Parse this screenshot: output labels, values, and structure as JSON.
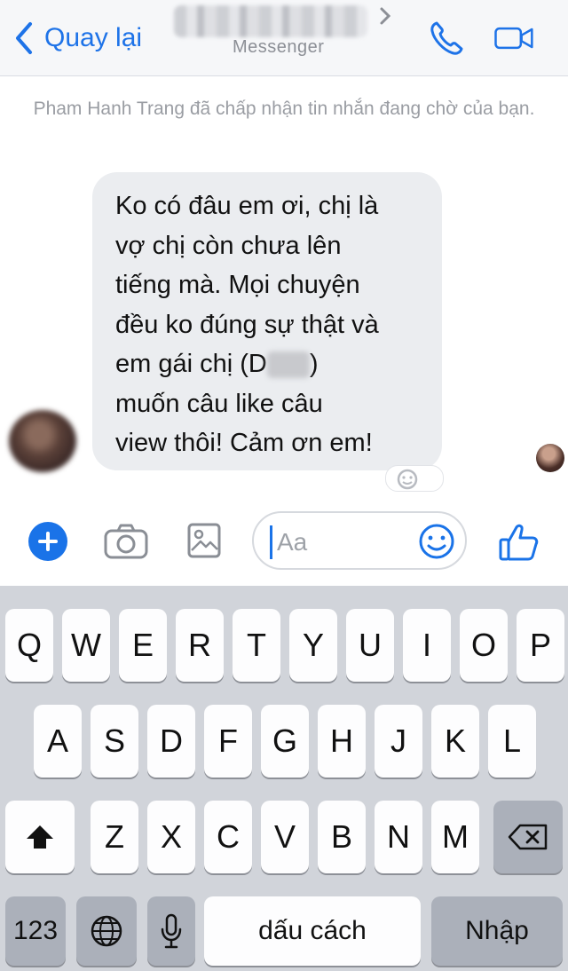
{
  "header": {
    "back_label": "Quay lại",
    "subtitle": "Messenger"
  },
  "notice": "Pham Hanh Trang đã chấp nhận tin nhắn đang chờ của bạn.",
  "message": {
    "lines": [
      "Ko có đâu em ơi, chị là",
      "vợ chị còn chưa lên",
      "tiếng mà. Mọi chuyện",
      "đều ko đúng sự thật và"
    ],
    "line5_prefix": "em gái chị (D",
    "line5_suffix": ")",
    "line6": "muốn câu like câu",
    "line7": "view thôi! Cảm ơn em!"
  },
  "composer": {
    "placeholder": "Aa"
  },
  "keyboard": {
    "row1": [
      "Q",
      "W",
      "E",
      "R",
      "T",
      "Y",
      "U",
      "I",
      "O",
      "P"
    ],
    "row2": [
      "A",
      "S",
      "D",
      "F",
      "G",
      "H",
      "J",
      "K",
      "L"
    ],
    "row3": [
      "Z",
      "X",
      "C",
      "V",
      "B",
      "N",
      "M"
    ],
    "numbers_label": "123",
    "space_label": "dấu cách",
    "return_label": "Nhập"
  },
  "colors": {
    "accent": "#1a73e8",
    "bubble": "#ebedf0",
    "keyboard_bg": "#d1d4da"
  },
  "icons": [
    "chevron-left-icon",
    "chevron-right-icon",
    "phone-icon",
    "video-camera-icon",
    "plus-icon",
    "camera-icon",
    "image-icon",
    "smiley-icon",
    "thumbs-up-icon",
    "shift-icon",
    "backspace-icon",
    "globe-icon",
    "microphone-icon"
  ]
}
